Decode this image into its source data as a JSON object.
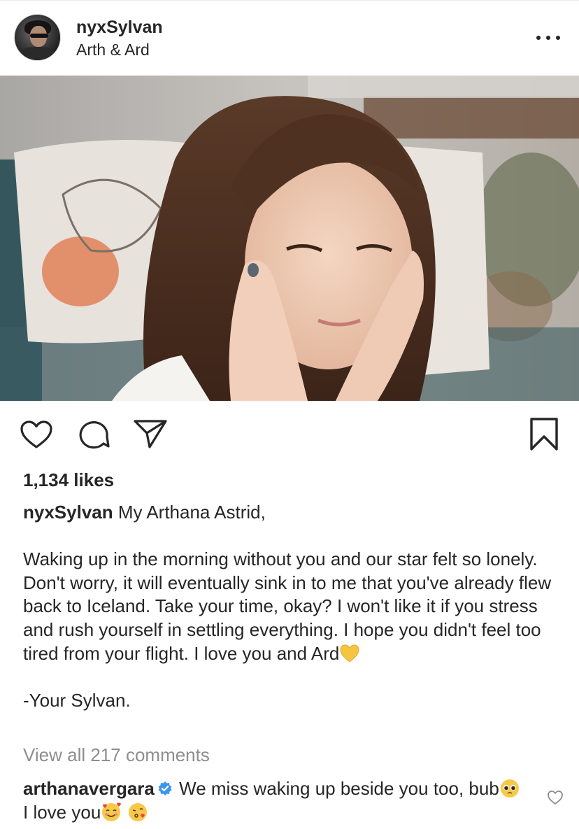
{
  "post": {
    "username": "nyxSylvan",
    "location": "Arth & Ard",
    "likes": "1,134 likes",
    "caption": {
      "username": "nyxSylvan",
      "first_line": "My Arthana Astrid,",
      "body": "Waking up in the morning without you and our star felt so lonely. Don't worry, it will eventually sink in to me that you've already flew back to Iceland. Take your time, okay? I won't like it if you stress and rush yourself in settling everything. I hope you didn't feel too tired from your flight. I love you and Ard",
      "signoff": "-Your Sylvan."
    },
    "view_comments": "View all 217 comments",
    "comment": {
      "username": "arthanavergara",
      "text_part1": "We miss waking up beside you too, bub",
      "text_part2": " I love you"
    }
  },
  "icons": {
    "actions": [
      "heart-icon",
      "comment-icon",
      "share-icon",
      "bookmark-icon"
    ],
    "more": "more-options-icon",
    "verified": "verified-badge-icon",
    "emojis": [
      "yellow-heart-emoji",
      "pleading-face-emoji",
      "smiling-face-with-hearts-emoji",
      "face-blowing-kiss-emoji"
    ]
  },
  "colors": {
    "text": "#262626",
    "muted": "#8e8e8e",
    "verified_blue": "#3897f0",
    "yellow_heart": "#f5c542"
  }
}
